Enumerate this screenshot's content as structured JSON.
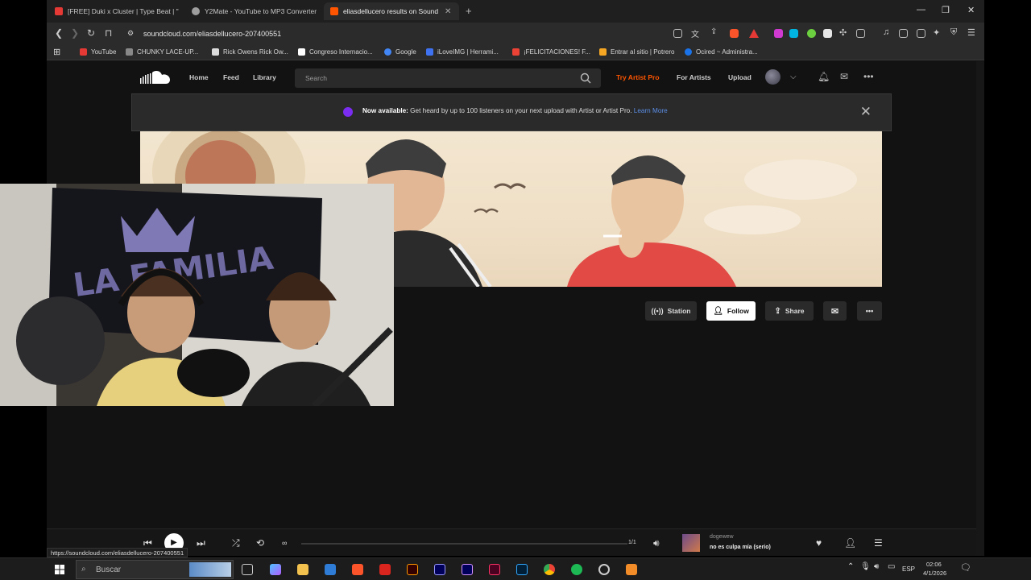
{
  "browser": {
    "tabs": [
      {
        "title": "[FREE] Duki x Cluster | Type Beat | \"Dr",
        "color": "#e53935"
      },
      {
        "title": "Y2Mate - YouTube to MP3 Converter",
        "color": "#9e9e9e"
      },
      {
        "title": "eliasdellucero results on SoundC",
        "color": "#ff5500",
        "active": true
      }
    ],
    "new_tab": "+",
    "url": "soundcloud.com/eliasdellucero-207400551",
    "bookmarks": [
      {
        "label": "YouTube",
        "color": "#e53935"
      },
      {
        "label": "CHUNKY LACE-UP...",
        "color": "#888888"
      },
      {
        "label": "Rick Owens Rick Ow...",
        "color": "#dddddd"
      },
      {
        "label": "Congreso Internacio...",
        "color": "#ffffff"
      },
      {
        "label": "Google",
        "color": "#4285f4"
      },
      {
        "label": "iLoveIMG | Herrami...",
        "color": "#3f72f0"
      },
      {
        "label": "¡FELICITACIONES! F...",
        "color": "#ea4335"
      },
      {
        "label": "Entrar al sitio | Potrero",
        "color": "#f5a623"
      },
      {
        "label": "Ocired ~ Administra...",
        "color": "#1a73e8"
      }
    ],
    "status_url": "https://soundcloud.com/eliasdellucero-207400551"
  },
  "soundcloud": {
    "nav": {
      "home": "Home",
      "feed": "Feed",
      "library": "Library"
    },
    "search_placeholder": "Search",
    "try_artist_pro": "Try Artist Pro",
    "for_artists": "For Artists",
    "upload": "Upload",
    "banner": {
      "bold": "Now available:",
      "text": " Get heard by up to 100 listeners on your next upload with Artist or Artist Pro. ",
      "link": "Learn More"
    },
    "actions": {
      "station": "Station",
      "follow": "Follow",
      "share": "Share"
    },
    "player": {
      "artist": "dogewew",
      "track": "no es culpa mía (serio)",
      "count": "1/1"
    }
  },
  "taskbar": {
    "search_placeholder": "Buscar",
    "lang": "ESP",
    "time": "02:06",
    "date": "4/1/2026"
  },
  "colors": {
    "accent": "#ff5500",
    "link": "#5b8ee6",
    "promo": "#7a2cf0"
  }
}
